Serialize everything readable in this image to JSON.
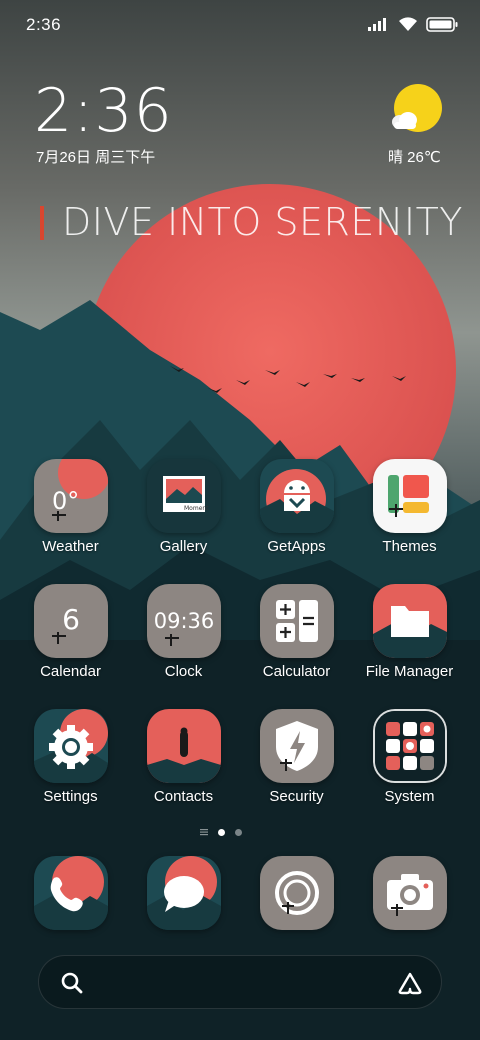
{
  "status_bar": {
    "time": "2:36"
  },
  "clock_widget": {
    "time": "2:36",
    "date": "7月26日 周三下午",
    "weather": "晴 26℃"
  },
  "headline": "DIVE INTO SERENITY",
  "apps": [
    {
      "label": "Weather",
      "icon": "weather-icon",
      "icon_text": "0°"
    },
    {
      "label": "Gallery",
      "icon": "gallery-icon",
      "icon_text": "Moment"
    },
    {
      "label": "GetApps",
      "icon": "getapps-icon"
    },
    {
      "label": "Themes",
      "icon": "themes-icon"
    },
    {
      "label": "Calendar",
      "icon": "calendar-icon",
      "icon_text": "6"
    },
    {
      "label": "Clock",
      "icon": "clock-icon",
      "icon_text": "09:36"
    },
    {
      "label": "Calculator",
      "icon": "calculator-icon"
    },
    {
      "label": "File Manager",
      "icon": "file-manager-icon"
    },
    {
      "label": "Settings",
      "icon": "settings-icon"
    },
    {
      "label": "Contacts",
      "icon": "contacts-icon"
    },
    {
      "label": "Security",
      "icon": "security-icon"
    },
    {
      "label": "System",
      "icon": "system-folder-icon"
    }
  ],
  "dock": [
    {
      "icon": "phone-icon"
    },
    {
      "icon": "messages-icon"
    },
    {
      "icon": "browser-icon"
    },
    {
      "icon": "camera-icon"
    }
  ],
  "page_indicator": {
    "pages": 2,
    "active": 1
  },
  "search_bar": {
    "left_icon": "search-icon",
    "right_icon": "assistant-icon"
  },
  "colors": {
    "sun": "#e8605a",
    "mountain": "#1d4a52",
    "headline_bar": "#d8462f",
    "weather_sun": "#f6d21a"
  }
}
